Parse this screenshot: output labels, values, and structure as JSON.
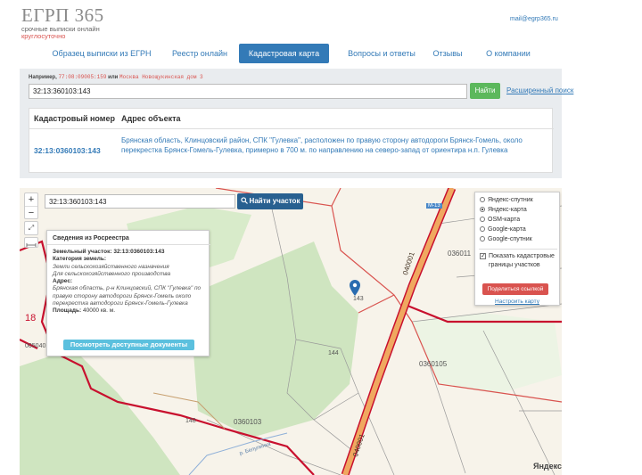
{
  "header": {
    "logo_title": "ЕГРП 365",
    "logo_sub": "срочные выписки онлайн",
    "logo_sub2": "круглосуточно",
    "email": "mail@egrp365.ru"
  },
  "nav": {
    "items": [
      {
        "label": "Образец выписки из ЕГРН",
        "active": false
      },
      {
        "label": "Реестр онлайн",
        "active": false
      },
      {
        "label": "Кадастровая карта",
        "active": true
      },
      {
        "label": "Вопросы и ответы",
        "active": false
      },
      {
        "label": "Отзывы",
        "active": false
      },
      {
        "label": "О компании",
        "active": false
      }
    ]
  },
  "search": {
    "example_prefix": "Например,",
    "example_code": "77:08:09005:159",
    "example_or": "или",
    "example_addr": "Москва Новощукинская дом 3",
    "value": "32:13:360103:143",
    "find_label": "Найти",
    "advanced_label": "Расширенный поиск"
  },
  "results": {
    "col_number": "Кадастровый номер",
    "col_address": "Адрес объекта",
    "row": {
      "number": "32:13:0360103:143",
      "address": "Брянская область, Клинцовский район, СПК \"Гулевка\", расположен по правую сторону автодороги Брянск-Гомель, около перекрестка Брянск-Гомель-Гулевка, примерно в 700 м. по направлению на северо-запад от ориентира н.п. Гулевка"
    }
  },
  "map": {
    "zoom_in": "+",
    "zoom_out": "−",
    "search_value": "32:13:360103:143",
    "find_plot_label": "Найти участок",
    "info": {
      "title": "Сведения из Росреестра",
      "plot_label": "Земельный участок:",
      "plot_number": "32:13:0360103:143",
      "category_label": "Категория земель:",
      "category_value": "Земли сельскохозяйственного назначения",
      "purpose_value": "Для сельскохозяйственного производства",
      "address_label": "Адрес:",
      "address_value": "Брянская область, р-н Клинцовский, СПК \"Гулевка\" по правую сторону автодороги Брянск-Гомель около перекрестка автодороги Брянск-Гомель-Гулевка",
      "area_label": "Площадь:",
      "area_value": "40000 кв. м.",
      "docs_button": "Посмотреть доступные документы"
    },
    "layers": {
      "options": [
        {
          "label": "Яндекс-спутник",
          "selected": false
        },
        {
          "label": "Яндекс-карта",
          "selected": true
        },
        {
          "label": "OSM-карта",
          "selected": false
        },
        {
          "label": "Google-карта",
          "selected": false
        },
        {
          "label": "Google-спутник",
          "selected": false
        }
      ],
      "show_borders_label": "Показать кадастровые границы участков",
      "show_borders_checked": true,
      "share_label": "Поделиться ссылкой",
      "setup_label": "Настроить карту"
    },
    "labels": {
      "plot_143": "143",
      "plot_144": "144",
      "plot_148": "148",
      "block_0360103": "0360103",
      "block_0360105": "0360105",
      "block_0360111": "036011",
      "block_005040": "005040",
      "side_18": "18",
      "road_m13": "М-13",
      "road_040": "040001",
      "road_040b": "040001",
      "river": "р. Белулинка",
      "yandex": "Яндекс"
    },
    "colors": {
      "accent": "#337ab7",
      "border_red": "#c8102e",
      "road_orange": "#f0a860",
      "forest_green": "#cfe5c0"
    }
  }
}
